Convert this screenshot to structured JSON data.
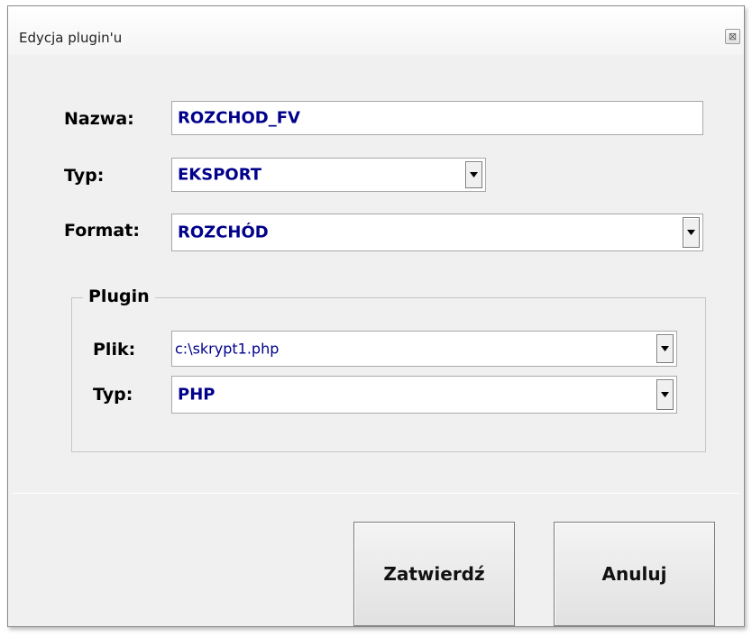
{
  "window": {
    "title": "Edycja plugin'u",
    "close_glyph": "⊠"
  },
  "form": {
    "nazwa_label": "Nazwa:",
    "nazwa_value": "ROZCHOD_FV",
    "typ_label": "Typ:",
    "typ_value": "EKSPORT",
    "format_label": "Format:",
    "format_value": "ROZCHÓD"
  },
  "plugin_group": {
    "legend": "Plugin",
    "plik_label": "Plik:",
    "plik_value": "c:\\skrypt1.php",
    "typ_label": "Typ:",
    "typ_value": "PHP"
  },
  "buttons": {
    "confirm_label": "Zatwierdź",
    "cancel_label": "Anuluj"
  },
  "icons": {
    "dropdown": "chevron-down-icon",
    "close": "close-icon"
  },
  "colors": {
    "value_text": "#00008b",
    "dialog_bg": "#f0f0f0"
  }
}
